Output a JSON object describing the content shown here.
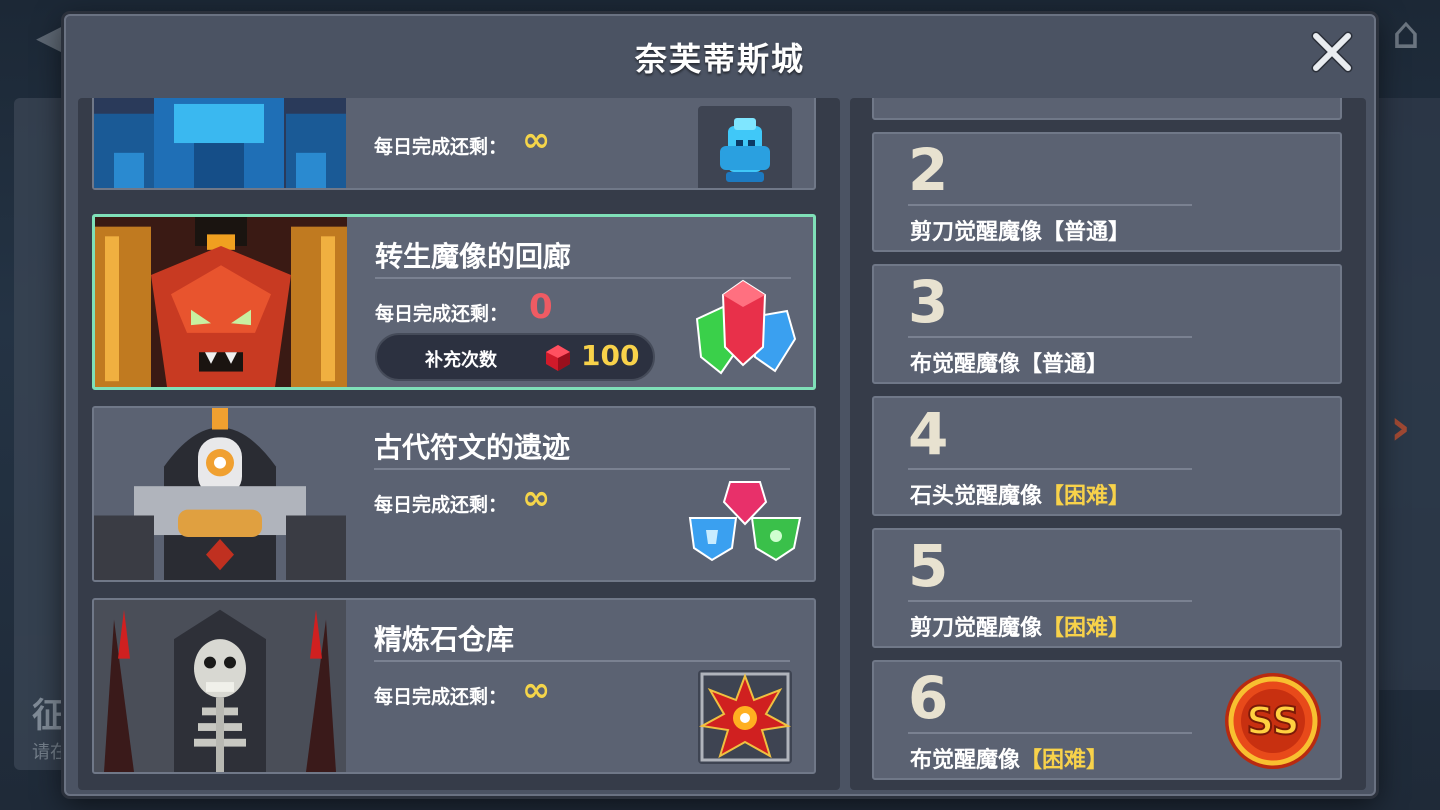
{
  "dialog": {
    "title": "奈芙蒂斯城"
  },
  "dungeons": [
    {
      "name": "",
      "remaining_label": "每日完成还剩：",
      "remaining_value": "∞"
    },
    {
      "name": "转生魔像的回廊",
      "remaining_label": "每日完成还剩：",
      "remaining_value": "0",
      "refill_label": "补充次数",
      "refill_cost": "100"
    },
    {
      "name": "古代符文的遗迹",
      "remaining_label": "每日完成还剩：",
      "remaining_value": "∞"
    },
    {
      "name": "精炼石仓库",
      "remaining_label": "每日完成还剩：",
      "remaining_value": "∞"
    }
  ],
  "stages": [
    {
      "number": "2",
      "name": "剪刀觉醒魔像",
      "difficulty": "【普通】",
      "level": "normal"
    },
    {
      "number": "3",
      "name": "布觉醒魔像",
      "difficulty": "【普通】",
      "level": "normal"
    },
    {
      "number": "4",
      "name": "石头觉醒魔像",
      "difficulty": "【困难】",
      "level": "hard"
    },
    {
      "number": "5",
      "name": "剪刀觉醒魔像",
      "difficulty": "【困难】",
      "level": "hard"
    },
    {
      "number": "6",
      "name": "布觉醒魔像",
      "difficulty": "【困难】",
      "level": "hard",
      "badge": "SS"
    }
  ],
  "background": {
    "left_card_title": "征",
    "left_card_sub": "请在"
  },
  "colors": {
    "selected_border": "#7fe0b8",
    "infinite": "#f5d54a",
    "zero": "#ef5b63",
    "hard": "#f8d24a"
  }
}
